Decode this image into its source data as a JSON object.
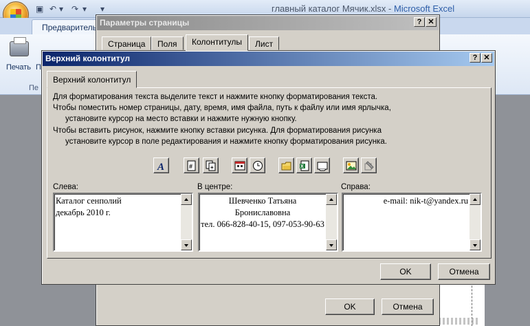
{
  "excel": {
    "window_title_file": "главный каталог Мячик.xlsx",
    "window_title_sep": " - ",
    "window_title_app": "Microsoft Excel",
    "ribbon_tab": "Предварительн",
    "print_label": "Печать",
    "print_label2": "П",
    "group_label": "Пе",
    "qa_glyph": "▾"
  },
  "page_setup": {
    "title": "Параметры страницы",
    "help_glyph": "?",
    "close_glyph": "✕",
    "tabs": [
      "Страница",
      "Поля",
      "Колонтитулы",
      "Лист"
    ],
    "active_tab": 2,
    "ok_label": "OK",
    "cancel_label": "Отмена"
  },
  "header_dialog": {
    "title": "Верхний колонтитул",
    "help_glyph": "?",
    "close_glyph": "✕",
    "tab_label": "Верхний колонтитул",
    "instructions": [
      "Для форматирования текста выделите текст и нажмите кнопку форматирования текста.",
      "Чтобы поместить номер страницы, дату, время, имя файла, путь к файлу или имя ярлычка,",
      "установите курсор на место вставки и нажмите нужную кнопку.",
      "Чтобы вставить рисунок, нажмите кнопку вставки рисунка.  Для форматирования рисунка",
      "установите курсор в поле редактирования и нажмите кнопку форматирования рисунка."
    ],
    "toolbar_icons": [
      "format-text-icon",
      "page-number-icon",
      "page-count-icon",
      "date-icon",
      "time-icon",
      "file-path-icon",
      "file-name-icon",
      "sheet-name-icon",
      "insert-picture-icon",
      "format-picture-icon"
    ],
    "sections": {
      "left": {
        "label": "Слева:",
        "lines": [
          "Каталог сенполий",
          "декабрь 2010 г."
        ]
      },
      "center": {
        "label": "В центре:",
        "lines": [
          "Шевченко Татьяна",
          "Брониславовна",
          "тел. 066-828-40-15, 097-053-90-63"
        ]
      },
      "right": {
        "label": "Справа:",
        "lines": [
          "e-mail: nik-t@yandex.ru"
        ]
      }
    },
    "ok_label": "OK",
    "cancel_label": "Отмена"
  },
  "colors": {
    "active_title_start": "#0a246a",
    "active_title_end": "#a6caf0",
    "dialog_face": "#d4d0c8"
  }
}
